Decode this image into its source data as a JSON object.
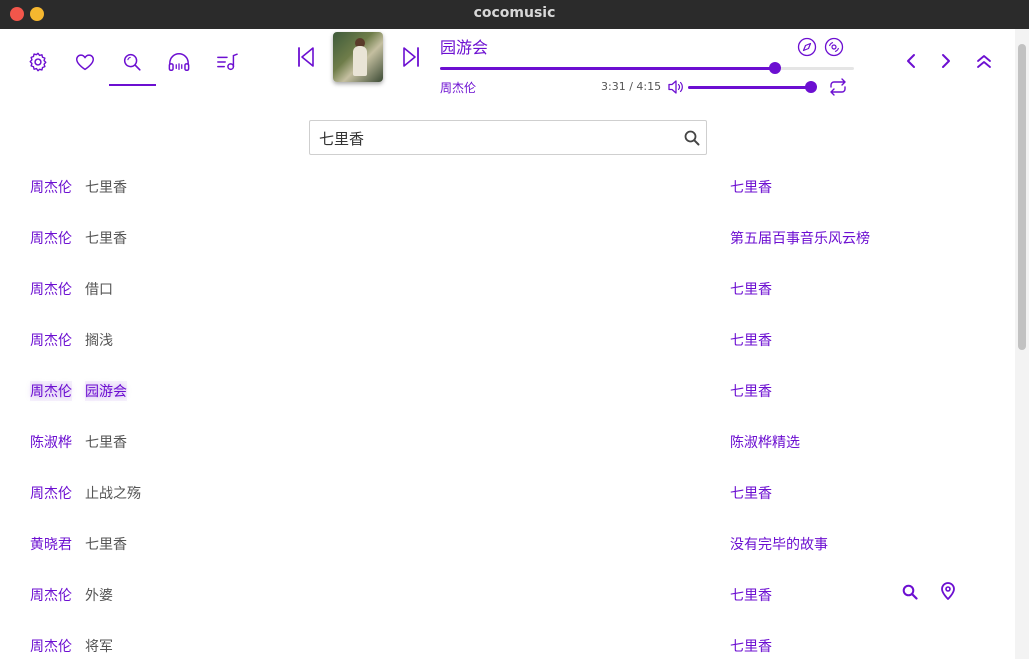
{
  "window": {
    "title": "cocomusic"
  },
  "nav": {
    "tabs": [
      {
        "name": "settings",
        "icon": "gear-icon"
      },
      {
        "name": "favorites",
        "icon": "heart-icon"
      },
      {
        "name": "search",
        "icon": "search-icon",
        "active": true
      },
      {
        "name": "listen",
        "icon": "headphones-icon"
      },
      {
        "name": "playlist",
        "icon": "music-list-icon"
      }
    ]
  },
  "player": {
    "title": "园游会",
    "artist": "周杰伦",
    "time": "3:31 / 4:15",
    "progress": 0.81,
    "volume": 1.0
  },
  "search": {
    "value": "七里香",
    "placeholder": ""
  },
  "results": [
    {
      "artist": "周杰伦",
      "song": "七里香",
      "album": "七里香"
    },
    {
      "artist": "周杰伦",
      "song": "七里香",
      "album": "第五届百事音乐风云榜"
    },
    {
      "artist": "周杰伦",
      "song": "借口",
      "album": "七里香"
    },
    {
      "artist": "周杰伦",
      "song": "搁浅",
      "album": "七里香"
    },
    {
      "artist": "周杰伦",
      "song": "园游会",
      "album": "七里香",
      "active": true
    },
    {
      "artist": "陈淑桦",
      "song": "七里香",
      "album": "陈淑桦精选"
    },
    {
      "artist": "周杰伦",
      "song": "止战之殇",
      "album": "七里香"
    },
    {
      "artist": "黄晓君",
      "song": "七里香",
      "album": "没有完毕的故事"
    },
    {
      "artist": "周杰伦",
      "song": "外婆",
      "album": "七里香"
    },
    {
      "artist": "周杰伦",
      "song": "将军",
      "album": "七里香"
    }
  ],
  "colors": {
    "accent": "#6c0fd1",
    "titlebar": "#2b2b2b"
  }
}
